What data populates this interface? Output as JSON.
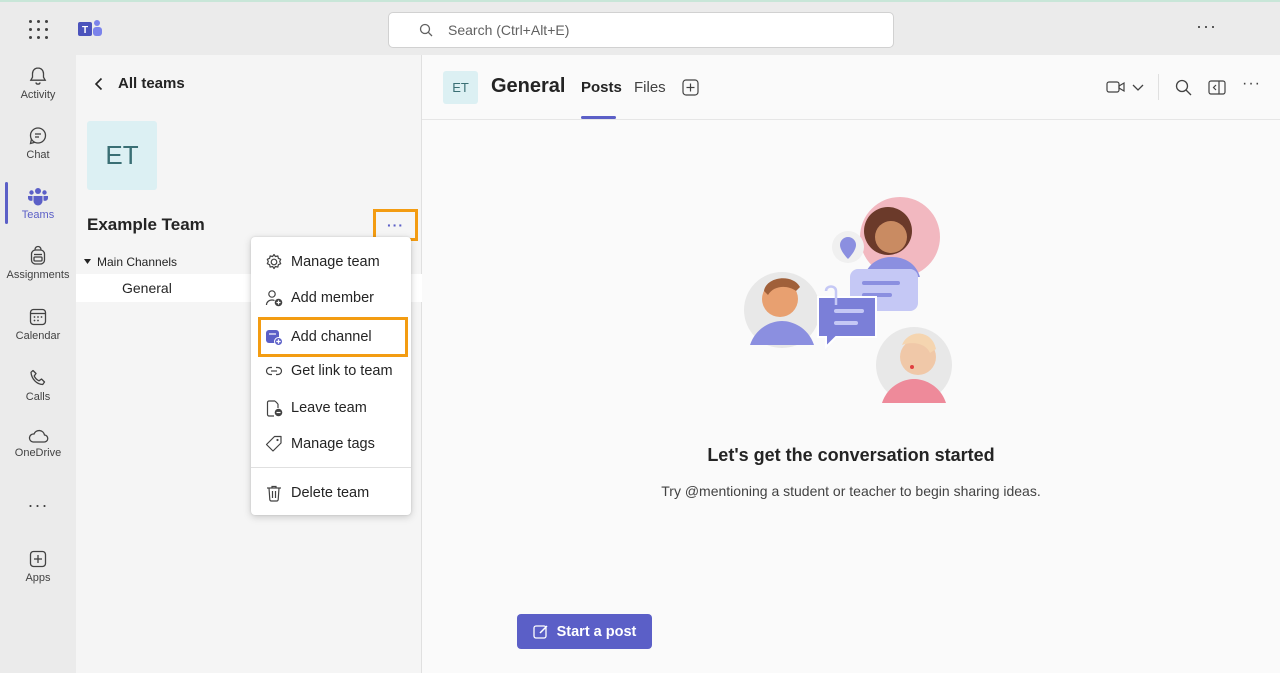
{
  "search": {
    "placeholder": "Search (Ctrl+Alt+E)"
  },
  "top_more": "···",
  "rail": {
    "items": [
      {
        "label": "Activity",
        "icon": "bell-icon"
      },
      {
        "label": "Chat",
        "icon": "chat-icon"
      },
      {
        "label": "Teams",
        "icon": "teams-icon"
      },
      {
        "label": "Assignments",
        "icon": "backpack-icon"
      },
      {
        "label": "Calendar",
        "icon": "calendar-icon"
      },
      {
        "label": "Calls",
        "icon": "phone-icon"
      },
      {
        "label": "OneDrive",
        "icon": "cloud-icon"
      },
      {
        "label": "Apps",
        "icon": "plus-square-icon"
      }
    ],
    "more": "···"
  },
  "team_panel": {
    "back_label": "All teams",
    "avatar_initials": "ET",
    "team_name": "Example Team",
    "more": "···",
    "channels_header": "Main Channels",
    "channels": [
      "General"
    ]
  },
  "context_menu": {
    "items": [
      {
        "label": "Manage team",
        "icon": "gear-icon"
      },
      {
        "label": "Add member",
        "icon": "add-person-icon"
      },
      {
        "label": "Add channel",
        "icon": "add-channel-icon"
      },
      {
        "label": "Get link to team",
        "icon": "link-icon"
      },
      {
        "label": "Leave team",
        "icon": "leave-icon"
      },
      {
        "label": "Manage tags",
        "icon": "tag-icon"
      },
      {
        "label": "Delete team",
        "icon": "trash-icon"
      }
    ]
  },
  "channel_header": {
    "avatar_initials": "ET",
    "title": "General",
    "tabs": [
      "Posts",
      "Files"
    ],
    "more": "···"
  },
  "empty_state": {
    "title": "Let's get the conversation started",
    "subtitle": "Try @mentioning a student or teacher to begin sharing ideas."
  },
  "start_post_label": "Start a post",
  "colors": {
    "accent": "#5b5fc7",
    "highlight": "#f39c12"
  }
}
